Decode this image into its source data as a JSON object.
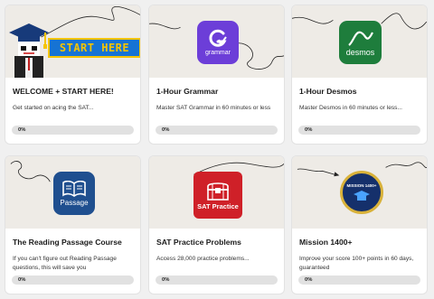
{
  "courses": [
    {
      "title": "WELCOME + START HERE!",
      "description": "Get started on acing the SAT...",
      "progress_label": "0%",
      "progress": 0,
      "thumb_text": "START HERE",
      "icon": "graduation-cap-mascot-icon"
    },
    {
      "title": "1-Hour Grammar",
      "description": "Master SAT Grammar in 60 minutes or less",
      "progress_label": "0%",
      "progress": 0,
      "thumb_text": "grammar",
      "icon": "grammarly-logo-icon",
      "color": "#6c3ed8"
    },
    {
      "title": "1-Hour Desmos",
      "description": "Master Desmos in 60 minutes or less...",
      "progress_label": "0%",
      "progress": 0,
      "thumb_text": "desmos",
      "icon": "desmos-logo-icon",
      "color": "#1e7d3c"
    },
    {
      "title": "The Reading Passage Course",
      "description": "If you can't figure out Reading Passage questions, this will save you",
      "progress_label": "0%",
      "progress": 0,
      "thumb_text": "Passage",
      "icon": "open-book-icon",
      "color": "#1f4f8f"
    },
    {
      "title": "SAT Practice Problems",
      "description": "Access 28,000 practice problems...",
      "progress_label": "0%",
      "progress": 0,
      "thumb_text": "SAT Practice",
      "icon": "treasure-chest-icon",
      "color": "#cf2028"
    },
    {
      "title": "Mission 1400+",
      "description": "Improve your score 100+ points in 60 days, guaranteed",
      "progress_label": "0%",
      "progress": 0,
      "thumb_text": "MISSION 1400+",
      "icon": "mission-badge-icon",
      "color": "#15306b"
    }
  ]
}
